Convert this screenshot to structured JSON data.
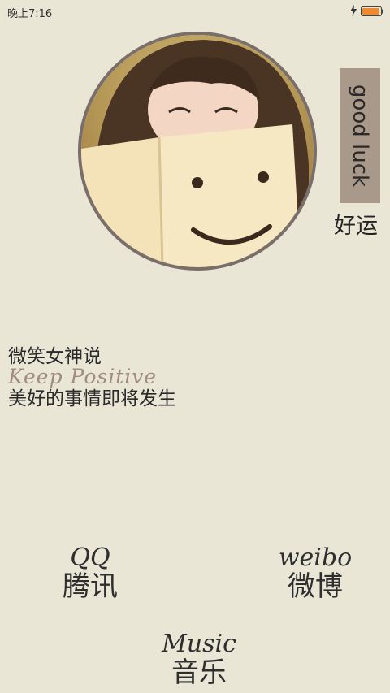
{
  "status_bar": {
    "time": "晚上7:16",
    "battery_level": 0.9,
    "battery_color": "#f08a2c"
  },
  "avatar": {
    "icon": "smiling-girl-photo"
  },
  "badge": {
    "text": "good luck",
    "color": "#a8998b"
  },
  "badge_caption": "好运",
  "quote": {
    "line1": "微笑女神说",
    "line2": "Keep Positive",
    "line3": "美好的事情即将发生"
  },
  "links": {
    "qq": {
      "en": "QQ",
      "zh": "腾讯"
    },
    "weibo": {
      "en": "weibo",
      "zh": "微博"
    },
    "music": {
      "en": "Music",
      "zh": "音乐"
    }
  },
  "colors": {
    "background": "#e9e6d6",
    "frame": "#7a6e6a"
  }
}
